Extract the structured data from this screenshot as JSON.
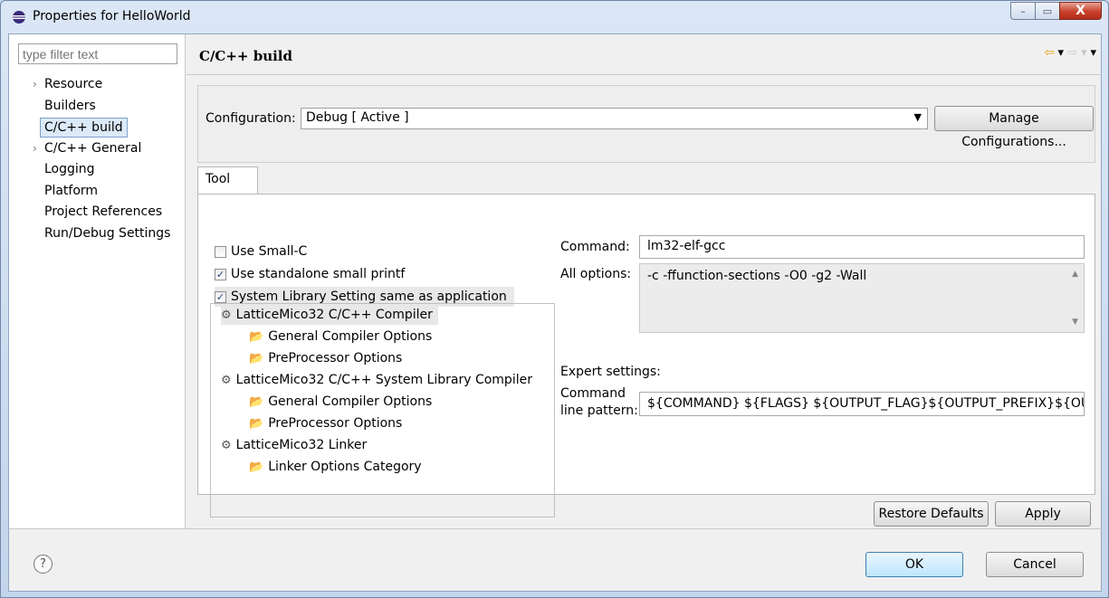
{
  "window": {
    "title": "Properties for HelloWorld",
    "minimize": "–",
    "maximize": "▭",
    "close": "X"
  },
  "left": {
    "filter_placeholder": "type filter text",
    "items": [
      {
        "label": "Resource",
        "expandable": true
      },
      {
        "label": "Builders",
        "expandable": false
      },
      {
        "label": "C/C++ build",
        "expandable": false,
        "selected": true
      },
      {
        "label": "C/C++ General",
        "expandable": true
      },
      {
        "label": "Logging",
        "expandable": false
      },
      {
        "label": "Platform",
        "expandable": false
      },
      {
        "label": "Project References",
        "expandable": false
      },
      {
        "label": "Run/Debug Settings",
        "expandable": false
      }
    ]
  },
  "page": {
    "title": "C/C++ build",
    "nav": {
      "back": "⇦",
      "back_menu": "▾",
      "forward": "⇨",
      "forward_menu": "▾",
      "view_menu": "▾"
    }
  },
  "config": {
    "label": "Configuration:",
    "value": "Debug  [ Active ]",
    "manage_label": "Manage Configurations..."
  },
  "tab": {
    "label": "Tool"
  },
  "checks": [
    {
      "label": "Use Small-C",
      "checked": false
    },
    {
      "label": "Use standalone small printf",
      "checked": true
    },
    {
      "label": "System Library Setting same as application",
      "checked": true
    }
  ],
  "tool_tree": [
    {
      "label": "LatticeMico32 C/C++ Compiler",
      "level": 0,
      "icon": "gear-icon",
      "selected": true
    },
    {
      "label": "General Compiler Options",
      "level": 1,
      "icon": "folder-icon"
    },
    {
      "label": "PreProcessor Options",
      "level": 1,
      "icon": "folder-icon"
    },
    {
      "label": "LatticeMico32 C/C++ System Library Compiler",
      "level": 0,
      "icon": "gear-icon"
    },
    {
      "label": "General Compiler Options",
      "level": 1,
      "icon": "folder-icon"
    },
    {
      "label": "PreProcessor Options",
      "level": 1,
      "icon": "folder-icon"
    },
    {
      "label": "LatticeMico32 Linker",
      "level": 0,
      "icon": "gear-icon"
    },
    {
      "label": "Linker Options Category",
      "level": 1,
      "icon": "folder-icon"
    }
  ],
  "settings": {
    "command_label": "Command:",
    "command_value": "lm32-elf-gcc",
    "all_options_label": "All options:",
    "all_options_value": "-c -ffunction-sections -O0 -g2 -Wall",
    "expert_label": "Expert settings:",
    "pattern_label_line1": "Command",
    "pattern_label_line2": "line pattern:",
    "pattern_value": "${COMMAND} ${FLAGS} ${OUTPUT_FLAG}${OUTPUT_PREFIX}${OUTPUT}"
  },
  "buttons": {
    "restore": "Restore Defaults",
    "apply": "Apply",
    "ok": "OK",
    "cancel": "Cancel",
    "help": "?"
  }
}
